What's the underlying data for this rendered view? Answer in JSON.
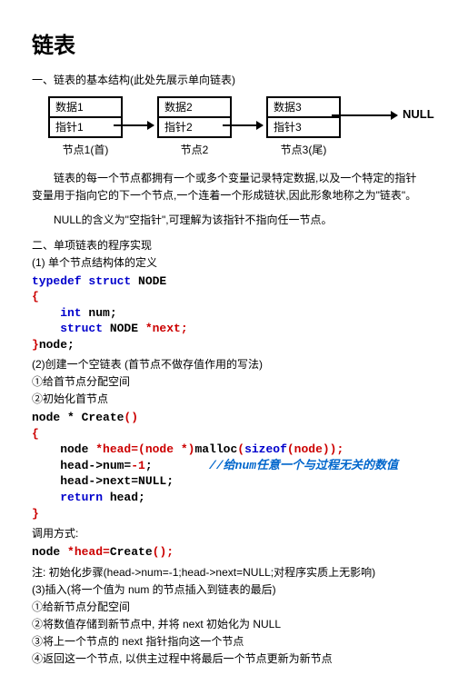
{
  "title": "链表",
  "section1_heading": "一、链表的基本结构(此处先展示单向链表)",
  "diagram": {
    "node1": {
      "data": "数据1",
      "ptr": "指针1",
      "label": "节点1(首)"
    },
    "node2": {
      "data": "数据2",
      "ptr": "指针2",
      "label": "节点2"
    },
    "node3": {
      "data": "数据3",
      "ptr": "指针3",
      "label": "节点3(尾)"
    },
    "null": "NULL"
  },
  "para1": "链表的每一个节点都拥有一个或多个变量记录特定数据,以及一个特定的指针变量用于指向它的下一个节点,一个连着一个形成链状,因此形象地称之为\"链表\"。",
  "para2": "NULL的含义为\"空指针\",可理解为该指针不指向任一节点。",
  "section2_heading": "二、单项链表的程序实现",
  "step1_label": "(1) 单个节点结构体的定义",
  "code1": {
    "l1a": "typedef",
    "l1b": " struct",
    "l1c": " NODE",
    "l2": "{",
    "l3a": "    int",
    "l3b": " num;",
    "l4a": "    struct",
    "l4b": " NODE ",
    "l4c": "*next;",
    "l5a": "}",
    "l5b": "node;"
  },
  "step2_label": "(2)创建一个空链表 (首节点不做存值作用的写法)",
  "step2_sub1": "①给首节点分配空间",
  "step2_sub2": "②初始化首节点",
  "code2": {
    "l1a": "node * ",
    "l1b": "Create",
    "l1c": "()",
    "l2": "{",
    "l3a": "    node ",
    "l3b": "*head=(node *)",
    "l3c": "malloc",
    "l3d": "(",
    "l3e": "sizeof",
    "l3f": "(node));",
    "l4a": "    head->num=",
    "l4b": "-1",
    "l4c": ";        ",
    "l4d": "//给num任意一个与过程无关的数值",
    "l5": "    head->next=NULL;",
    "l6a": "    return",
    "l6b": " head;",
    "l7": "}"
  },
  "call_label": "调用方式:",
  "code3": {
    "l1a": "node ",
    "l1b": "*head=",
    "l1c": "Create",
    "l1d": "();"
  },
  "note_line": "注: 初始化步骤(head->num=-1;head->next=NULL;对程序实质上无影响)",
  "step3_label": "(3)插入(将一个值为 num 的节点插入到链表的最后)",
  "step3_sub1": "①给新节点分配空间",
  "step3_sub2": "②将数值存储到新节点中, 并将 next 初始化为 NULL",
  "step3_sub3": "③将上一个节点的 next 指针指向这一个节点",
  "step3_sub4": "④返回这一个节点, 以供主过程中将最后一个节点更新为新节点"
}
